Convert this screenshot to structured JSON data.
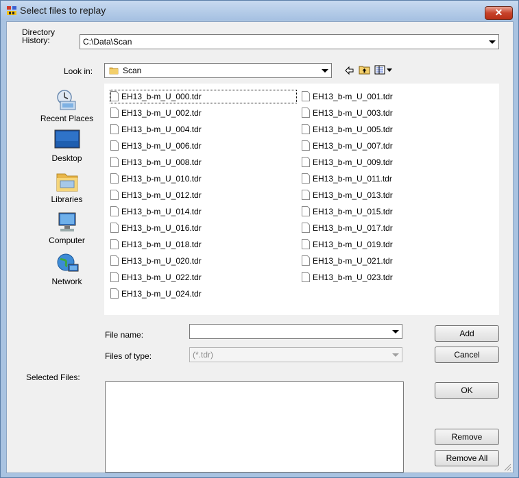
{
  "window": {
    "title": "Select files to replay",
    "close_glyph": "✕"
  },
  "directory_history": {
    "label": "Directory\nHistory:",
    "label_line1": "Directory",
    "label_line2": "History:",
    "value": "C:\\Data\\Scan"
  },
  "look_in": {
    "label": "Look in:",
    "value": "Scan"
  },
  "toolbar": {
    "back_icon": "back-arrow-icon",
    "up_icon": "up-folder-icon",
    "view_icon": "view-menu-icon"
  },
  "places": [
    {
      "label": "Recent Places",
      "icon": "recent-places-icon"
    },
    {
      "label": "Desktop",
      "icon": "desktop-icon"
    },
    {
      "label": "Libraries",
      "icon": "libraries-icon"
    },
    {
      "label": "Computer",
      "icon": "computer-icon"
    },
    {
      "label": "Network",
      "icon": "network-icon"
    }
  ],
  "files": [
    "EH13_b-m_U_000.tdr",
    "EH13_b-m_U_001.tdr",
    "EH13_b-m_U_002.tdr",
    "EH13_b-m_U_003.tdr",
    "EH13_b-m_U_004.tdr",
    "EH13_b-m_U_005.tdr",
    "EH13_b-m_U_006.tdr",
    "EH13_b-m_U_007.tdr",
    "EH13_b-m_U_008.tdr",
    "EH13_b-m_U_009.tdr",
    "EH13_b-m_U_010.tdr",
    "EH13_b-m_U_011.tdr",
    "EH13_b-m_U_012.tdr",
    "EH13_b-m_U_013.tdr",
    "EH13_b-m_U_014.tdr",
    "EH13_b-m_U_015.tdr",
    "EH13_b-m_U_016.tdr",
    "EH13_b-m_U_017.tdr",
    "EH13_b-m_U_018.tdr",
    "EH13_b-m_U_019.tdr",
    "EH13_b-m_U_020.tdr",
    "EH13_b-m_U_021.tdr",
    "EH13_b-m_U_022.tdr",
    "EH13_b-m_U_023.tdr",
    "EH13_b-m_U_024.tdr"
  ],
  "file_name": {
    "label": "File name:",
    "value": ""
  },
  "files_of_type": {
    "label": "Files of type:",
    "value": "(*.tdr)"
  },
  "selected_files": {
    "label": "Selected Files:"
  },
  "buttons": {
    "add": "Add",
    "cancel": "Cancel",
    "ok": "OK",
    "remove": "Remove",
    "remove_all": "Remove All"
  },
  "colors": {
    "title_bar": "#b9cfe9",
    "close_button": "#c7432b",
    "dialog_bg": "#f0f0f0"
  }
}
